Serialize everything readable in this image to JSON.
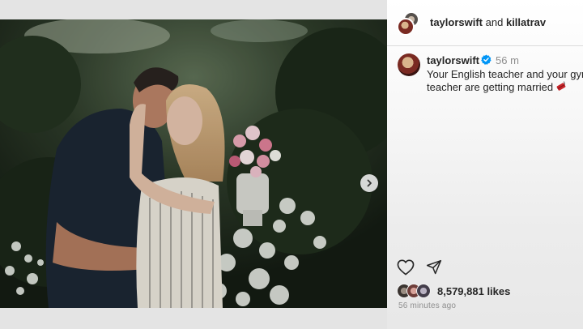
{
  "post": {
    "header": {
      "author": "taylorswift",
      "connector": "and",
      "collaborator": "killatrav"
    },
    "caption": {
      "username": "taylorswift",
      "verified": true,
      "time": "56 m",
      "line1": "Your English teacher and your gym",
      "line2": "teacher are getting married"
    },
    "likes": "8,579,881 likes",
    "posted_ago": "56 minutes ago"
  },
  "icons": {
    "next": "chevron-right-icon",
    "like": "heart-outline-icon",
    "share": "paper-plane-icon",
    "verified": "verified-badge-icon",
    "emoji": "dynamite-emoji-icon"
  },
  "colors": {
    "text": "#262626",
    "muted": "#8e8e8e",
    "verified": "#0095f6",
    "divider": "#dbdbdb"
  }
}
